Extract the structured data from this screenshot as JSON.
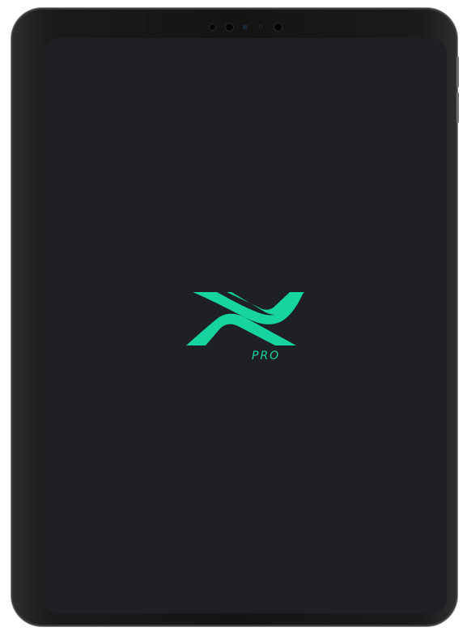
{
  "app": {
    "brand_mark": "x-logo-icon",
    "product_tag": "PRO"
  },
  "colors": {
    "screen_background": "#1f2024",
    "accent": "#16d3a0",
    "device_frame": "#141414"
  },
  "device": {
    "type": "tablet",
    "camera_icons": [
      "camera-lens-icon",
      "sensor-icon",
      "flash-icon",
      "mic-icon"
    ]
  }
}
